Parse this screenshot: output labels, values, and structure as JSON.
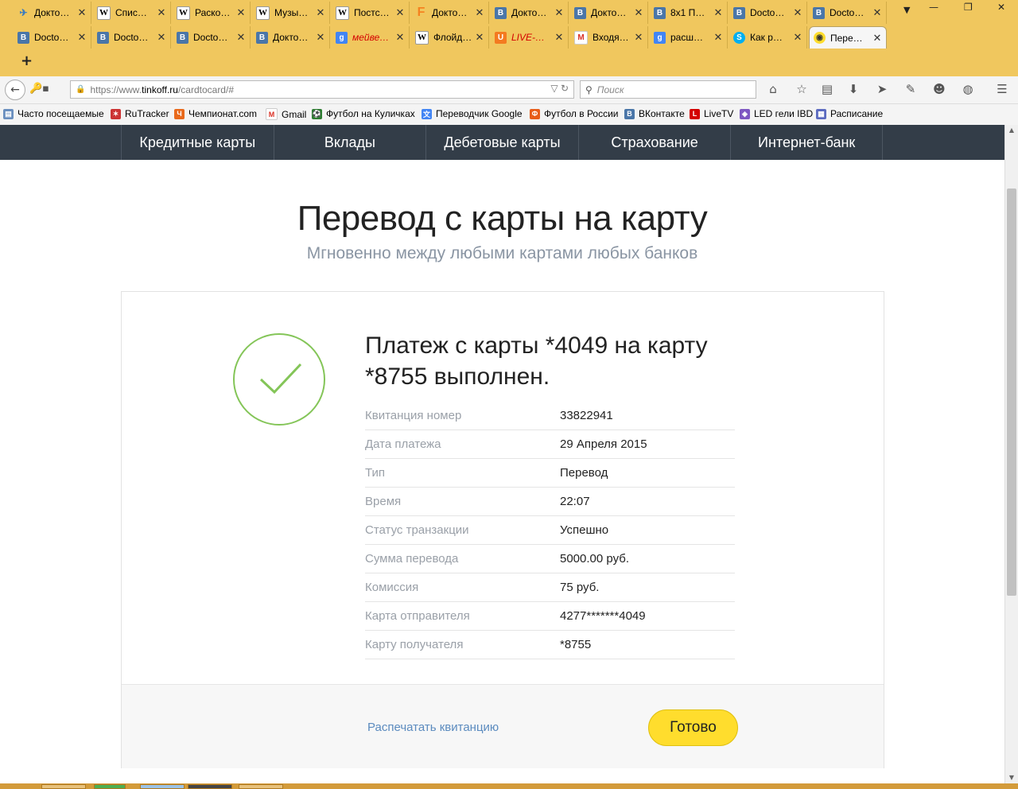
{
  "browser": {
    "tabs_row1": [
      {
        "icon": "bird",
        "title": "Докто…"
      },
      {
        "icon": "wiki",
        "title": "Спис…"
      },
      {
        "icon": "wiki",
        "title": "Раско…"
      },
      {
        "icon": "wiki",
        "title": "Музы…"
      },
      {
        "icon": "wiki",
        "title": "Постс…"
      },
      {
        "icon": "ff",
        "title": "Докто…"
      },
      {
        "icon": "vk",
        "title": "Докто…"
      },
      {
        "icon": "vk",
        "title": "Докто…"
      },
      {
        "icon": "vk",
        "title": "8х1 П…"
      },
      {
        "icon": "vk",
        "title": "Docto…"
      },
      {
        "icon": "vk",
        "title": "Docto…"
      }
    ],
    "tabs_row2": [
      {
        "icon": "vk",
        "title": "Docto…"
      },
      {
        "icon": "vk",
        "title": "Docto…"
      },
      {
        "icon": "vk",
        "title": "Docto…"
      },
      {
        "icon": "vk",
        "title": "Докто…"
      },
      {
        "icon": "gg",
        "title": "мейве…",
        "style": "red"
      },
      {
        "icon": "wiki",
        "title": "Флойд…"
      },
      {
        "icon": "lv",
        "title": "LIVE-…",
        "style": "red"
      },
      {
        "icon": "gm",
        "title": "Входя…"
      },
      {
        "icon": "gg",
        "title": "расш…"
      },
      {
        "icon": "sk",
        "title": "Как р…"
      },
      {
        "icon": "tk",
        "title": "Пере…",
        "active": true
      }
    ],
    "url_prefix": "https://www.",
    "url_host": "tinkoff.ru",
    "url_path": "/cardtocard/#",
    "search_placeholder": "Поиск",
    "bookmarks": [
      {
        "icon": "book",
        "label": "Часто посещаемые"
      },
      {
        "icon": "rt",
        "label": "RuTracker"
      },
      {
        "icon": "ch",
        "label": "Чемпионат.com"
      },
      {
        "icon": "gm",
        "label": "Gmail"
      },
      {
        "icon": "fk",
        "label": "Футбол на Куличках"
      },
      {
        "icon": "gt",
        "label": "Переводчик Google"
      },
      {
        "icon": "fr",
        "label": "Футбол в России"
      },
      {
        "icon": "vk",
        "label": "ВКонтакте"
      },
      {
        "icon": "live",
        "label": "LiveTV"
      },
      {
        "icon": "led",
        "label": "LED гели IBD"
      },
      {
        "icon": "cal",
        "label": "Расписание"
      }
    ]
  },
  "site_nav": [
    "Кредитные карты",
    "Вклады",
    "Дебетовые карты",
    "Страхование",
    "Интернет-банк"
  ],
  "page": {
    "title": "Перевод с карты на карту",
    "subtitle": "Мгновенно между любыми картами любых банков"
  },
  "receipt": {
    "headline_line1": "Платеж с карты *4049 на карту",
    "headline_line2": "*8755 выполнен.",
    "rows": [
      {
        "label": "Квитанция номер",
        "value": "33822941"
      },
      {
        "label": "Дата платежа",
        "value": "29 Апреля 2015"
      },
      {
        "label": "Тип",
        "value": "Перевод"
      },
      {
        "label": "Время",
        "value": "22:07"
      },
      {
        "label": "Статус транзакции",
        "value": "Успешно"
      },
      {
        "label": "Сумма перевода",
        "value": "5000.00 руб."
      },
      {
        "label": "Комиссия",
        "value": "75 руб."
      },
      {
        "label": "Карта отправителя",
        "value": "4277*******4049"
      },
      {
        "label": "Карту получателя",
        "value": "*8755"
      }
    ],
    "print_label": "Распечатать квитанцию",
    "done_label": "Готово"
  },
  "colors": {
    "accent_yellow": "#ffdd2d",
    "nav_dark": "#333d48",
    "success_green": "#84c558",
    "link_blue": "#5b8bbf",
    "chrome_orange": "#f0c75e"
  }
}
